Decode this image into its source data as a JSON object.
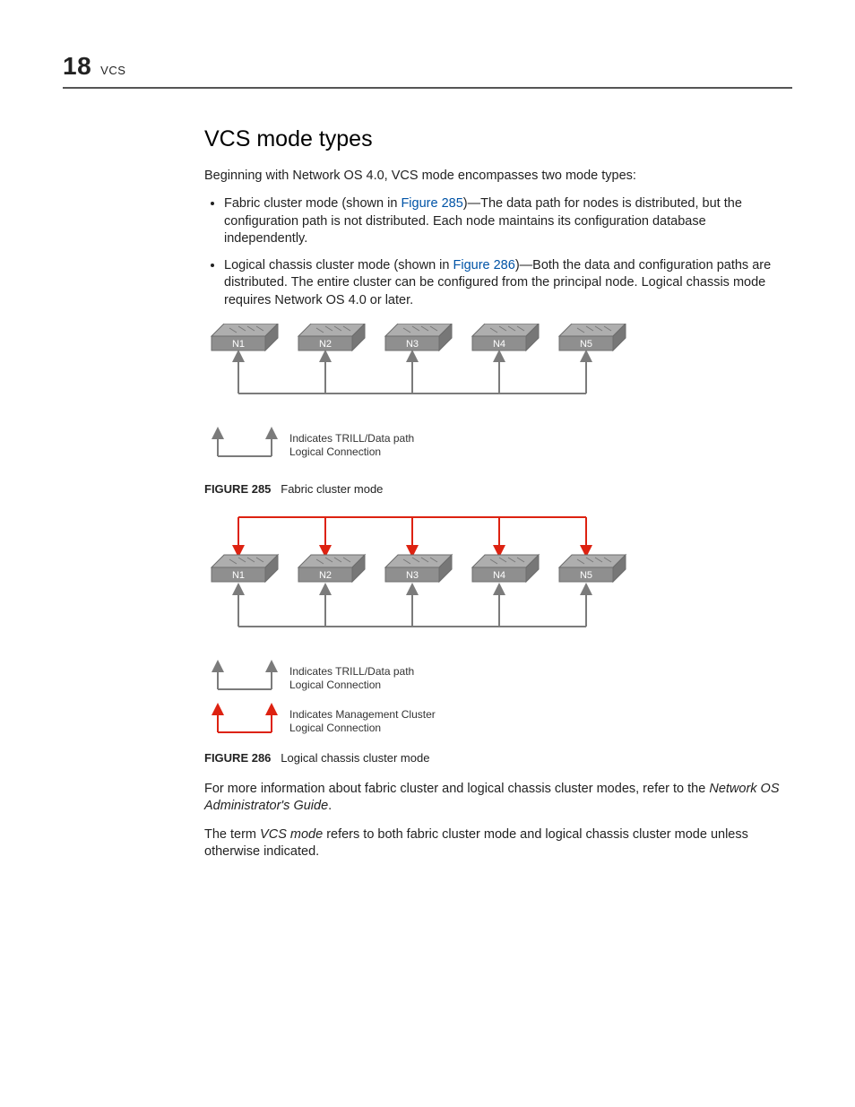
{
  "header": {
    "chapter_number": "18",
    "chapter_title": "VCS"
  },
  "section_title": "VCS mode types",
  "intro": "Beginning with Network OS 4.0, VCS mode encompasses two mode types:",
  "bullets": [
    {
      "lead": "Fabric cluster mode (shown in ",
      "link": "Figure 285",
      "tail": ")—The data path for nodes is distributed, but the configuration path is not distributed.  Each node maintains its configuration database independently."
    },
    {
      "lead": "Logical chassis cluster mode (shown in ",
      "link": "Figure 286",
      "tail": ")—Both the data and configuration paths are distributed. The entire cluster can be configured from the principal node. Logical chassis mode requires Network OS 4.0 or later."
    }
  ],
  "figure285": {
    "nodes": [
      "N1",
      "N2",
      "N3",
      "N4",
      "N5"
    ],
    "legend_line1": "Indicates TRILL/Data path",
    "legend_line2": "Logical Connection",
    "caption_label": "FIGURE 285",
    "caption_text": "Fabric cluster mode"
  },
  "figure286": {
    "nodes": [
      "N1",
      "N2",
      "N3",
      "N4",
      "N5"
    ],
    "legend1_line1": "Indicates TRILL/Data path",
    "legend1_line2": "Logical Connection",
    "legend2_line1": "Indicates Management Cluster",
    "legend2_line2": "Logical Connection",
    "caption_label": "FIGURE 286",
    "caption_text": "Logical chassis cluster mode"
  },
  "para_after1_a": "For more information about fabric cluster and logical chassis cluster modes, refer to the ",
  "para_after1_italic": "Network OS Administrator's Guide",
  "para_after1_b": ".",
  "para_after2_a": "The term ",
  "para_after2_italic": "VCS mode",
  "para_after2_b": " refers to both fabric cluster mode and logical chassis cluster mode unless otherwise indicated."
}
